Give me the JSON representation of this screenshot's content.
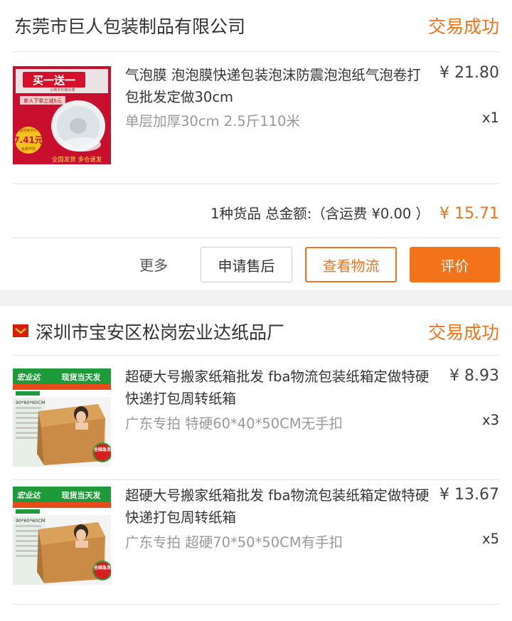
{
  "orders": [
    {
      "shop_name": "东莞市巨人包装制品有限公司",
      "status": "交易成功",
      "items": [
        {
          "title": "气泡膜 泡泡膜快递包装泡沫防震泡泡纸气泡卷打包批发定做30cm",
          "price": "¥ 21.80",
          "spec": "单层加厚30cm 2.5斤110米",
          "qty": "x1",
          "thumb": {
            "banner": "买一送一",
            "sub": "以到手价格为准",
            "promo": "新人下单立减5元",
            "price_tag": "7.41元",
            "tag_top": "最低到手价",
            "tag_bottom": "免费开票",
            "footer": "全国发货 多仓速发"
          }
        }
      ],
      "summary": {
        "text": "1种货品 总金额:（含运费 ¥0.00 ）",
        "amount": "¥ 15.71"
      },
      "actions": {
        "more": "更多",
        "after_sale": "申请售后",
        "logistics": "查看物流",
        "review": "评价"
      }
    },
    {
      "shop_name": "深圳市宝安区松岗宏业达纸品厂",
      "status": "交易成功",
      "items": [
        {
          "title": "超硬大号搬家纸箱批发 fba物流包装纸箱定做特硬快递打包周转纸箱",
          "price": "¥ 8.93",
          "spec": "广东专拍 特硬60*40*50CM无手扣",
          "qty": "x3",
          "thumb": {
            "brand": "宏业达",
            "headline": "现货当天发",
            "size": "90*60*60CM",
            "badge": "全国急发"
          }
        },
        {
          "title": "超硬大号搬家纸箱批发 fba物流包装纸箱定做特硬快递打包周转纸箱",
          "price": "¥ 13.67",
          "spec": "广东专拍 超硬70*50*50CM有手扣",
          "qty": "x5",
          "thumb": {
            "brand": "宏业达",
            "headline": "现货当天发",
            "size": "90*60*60CM",
            "badge": "全国急发"
          }
        }
      ]
    }
  ],
  "colors": {
    "accent": "#f2731a",
    "text": "#333333",
    "muted": "#999999",
    "divider": "#e6e6e6",
    "gap": "#f2f2f2"
  }
}
